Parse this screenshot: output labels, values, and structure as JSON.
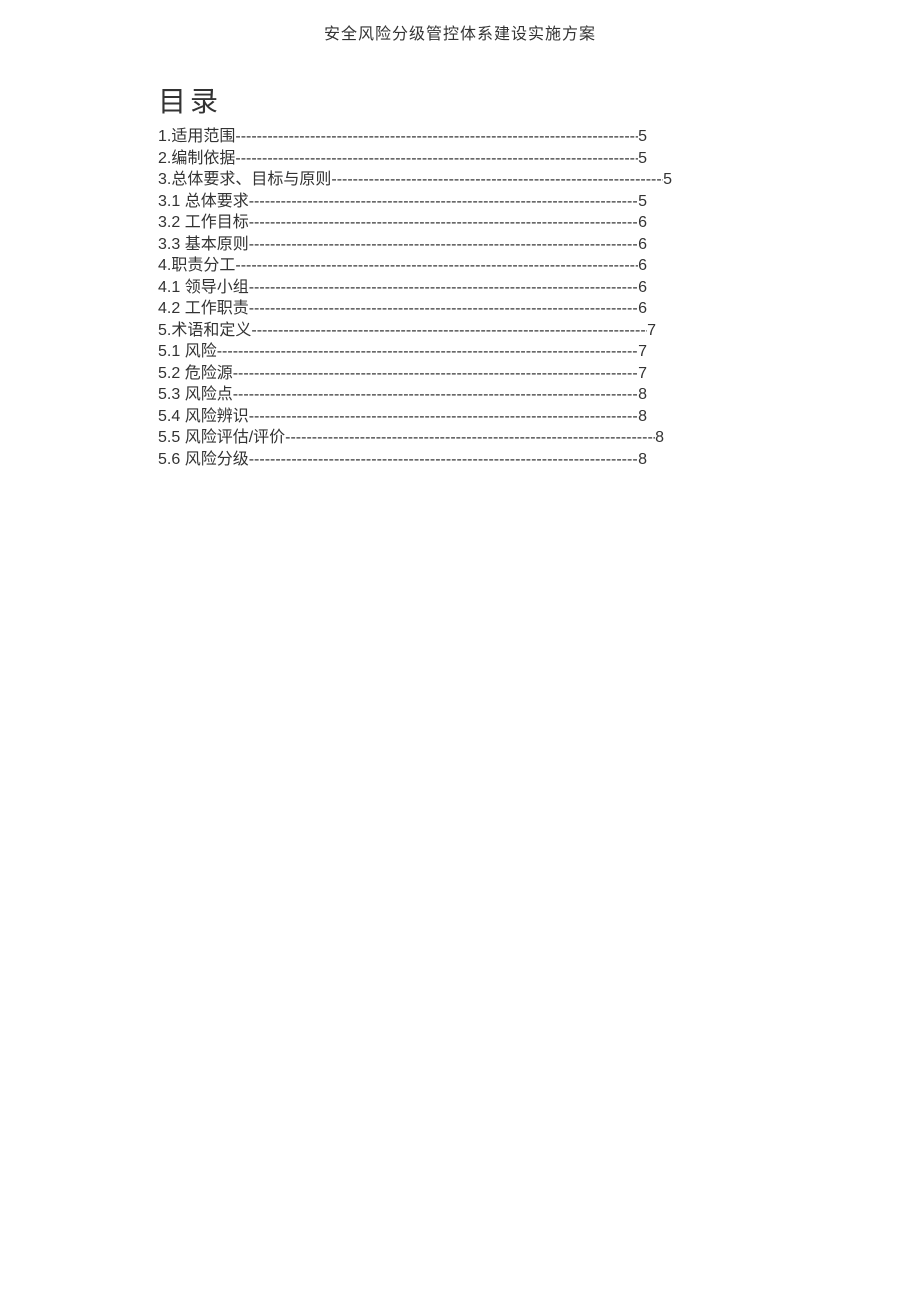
{
  "header": {
    "title": "安全风险分级管控体系建设实施方案"
  },
  "toc": {
    "heading": "目录",
    "items": [
      {
        "label": "1.适用范围",
        "page": "5",
        "wclass": "w-a"
      },
      {
        "label": "2.编制依据",
        "page": "5",
        "wclass": "w-a"
      },
      {
        "label": "3.总体要求、目标与原则",
        "page": "5",
        "wclass": "w-b"
      },
      {
        "label": "3.1 总体要求",
        "page": "5",
        "wclass": "w-a"
      },
      {
        "label": "3.2 工作目标",
        "page": "6",
        "wclass": "w-a"
      },
      {
        "label": "3.3 基本原则",
        "page": "6",
        "wclass": "w-a"
      },
      {
        "label": "4.职责分工",
        "page": "6",
        "wclass": "w-a"
      },
      {
        "label": "4.1 领导小组",
        "page": "6",
        "wclass": "w-a"
      },
      {
        "label": "4.2 工作职责",
        "page": "6",
        "wclass": "w-a"
      },
      {
        "label": "5.术语和定义",
        "page": "7",
        "wclass": "w-c"
      },
      {
        "label": "5.1 风险",
        "page": "7",
        "wclass": "w-a"
      },
      {
        "label": "5.2 危险源",
        "page": "7",
        "wclass": "w-a"
      },
      {
        "label": "5.3 风险点",
        "page": "8",
        "wclass": "w-a"
      },
      {
        "label": "5.4 风险辨识",
        "page": "8",
        "wclass": "w-a"
      },
      {
        "label": "5.5 风险评估/评价",
        "page": "8",
        "wclass": "w-d"
      },
      {
        "label": "5.6 风险分级",
        "page": "8",
        "wclass": "w-a"
      }
    ]
  }
}
